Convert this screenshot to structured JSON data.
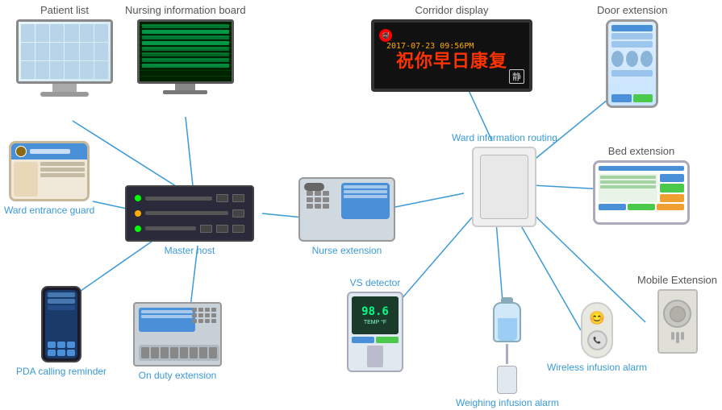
{
  "devices": {
    "patient_list": {
      "label": "Patient list",
      "label_position": "above"
    },
    "nursing_board": {
      "label": "Nursing information board",
      "label_position": "above"
    },
    "corridor_display": {
      "label": "Corridor display",
      "label_position": "above",
      "time": "2017-07-23   09:56PM",
      "text": "祝你早日康复",
      "quiet": "静"
    },
    "door_extension": {
      "label": "Door extension",
      "label_position": "above"
    },
    "ward_entrance": {
      "label": "Ward entrance guard",
      "label_position": "below"
    },
    "master_host": {
      "label": "Master host",
      "label_position": "below"
    },
    "nurse_extension": {
      "label": "Nurse extension",
      "label_position": "below"
    },
    "ward_routing": {
      "label": "Ward information routing",
      "label_position": "below"
    },
    "bed_extension": {
      "label": "Bed extension",
      "label_position": "above"
    },
    "pda_reminder": {
      "label": "PDA calling reminder",
      "label_position": "below"
    },
    "on_duty": {
      "label": "On duty extension",
      "label_position": "below"
    },
    "vs_detector": {
      "label": "VS detector",
      "label_position": "above"
    },
    "weighing_alarm": {
      "label": "Weighing infusion alarm",
      "label_position": "below"
    },
    "wireless_alarm": {
      "label": "Wireless infusion alarm",
      "label_position": "below"
    },
    "mobile_extension": {
      "label": "Mobile Extension",
      "label_position": "above"
    }
  },
  "line_color": "#3a9ad9"
}
